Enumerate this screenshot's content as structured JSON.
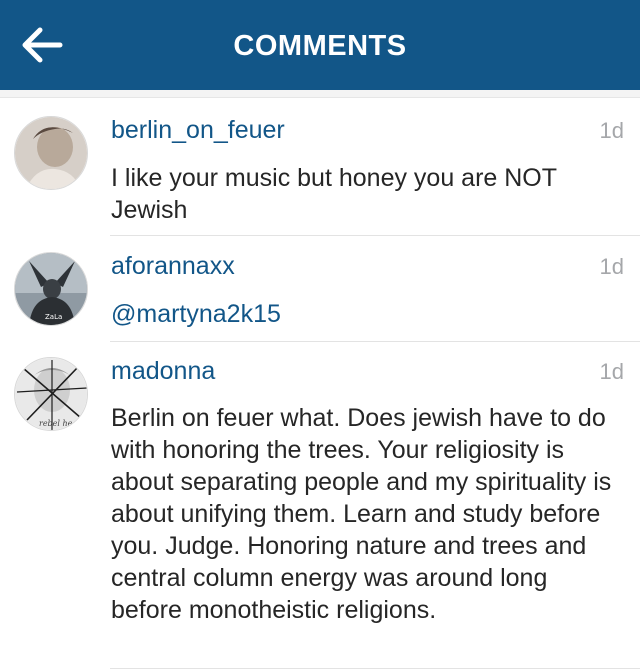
{
  "header": {
    "title": "COMMENTS",
    "back_icon": "arrow-left-icon",
    "background_color": "#125688"
  },
  "comments": [
    {
      "username": "berlin_on_feuer",
      "timestamp": "1d",
      "text": "I like your music but honey you are NOT Jewish"
    },
    {
      "username": "aforannaxx",
      "timestamp": "1d",
      "text": "@martyna2k15"
    },
    {
      "username": "madonna",
      "timestamp": "1d",
      "text": "Berlin on feuer what. Does jewish have to do with honoring the trees. Your religiosity is about separating people and my spirituality is about unifying them. Learn and study before you. Judge. Honoring nature and trees and central column energy was around long before monotheistic religions."
    }
  ],
  "colors": {
    "username": "#125688",
    "timestamp": "#a5a7aa",
    "text": "#262626"
  }
}
